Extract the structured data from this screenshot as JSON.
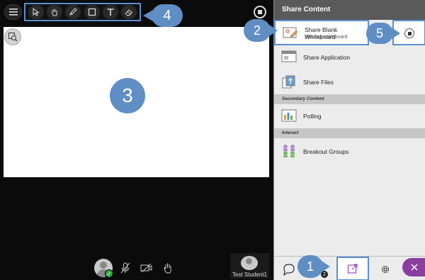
{
  "panel": {
    "title": "Share Content",
    "items": {
      "whiteboard": {
        "label": "Share Blank Whiteboard",
        "sublabel": "Sharing whiteboard"
      },
      "application": {
        "label": "Share Application"
      },
      "files": {
        "label": "Share Files"
      },
      "polling": {
        "label": "Polling"
      },
      "breakout": {
        "label": "Breakout Groups"
      }
    },
    "sections": {
      "secondary": "Secondary Content",
      "interact": "Interact"
    },
    "chat_notification_count": "2"
  },
  "stage": {
    "student_name": "Test Student1"
  },
  "callouts": {
    "c1": "1",
    "c2": "2",
    "c3": "3",
    "c4": "4",
    "c5": "5"
  },
  "icons": {
    "menu": "hamburger-icon",
    "tools": [
      "pointer-icon",
      "pan-hand-icon",
      "pencil-icon",
      "rectangle-icon",
      "text-icon",
      "eraser-icon"
    ],
    "stop": "stop-icon",
    "chat": "chat-icon",
    "share": "share-content-icon",
    "settings": "gear-icon",
    "close": "close-icon"
  },
  "colors": {
    "highlight": "#5b8fd0",
    "callout": "#5f8ec4",
    "close_accent": "#8a3fa0",
    "presence": "#2eaa42"
  }
}
